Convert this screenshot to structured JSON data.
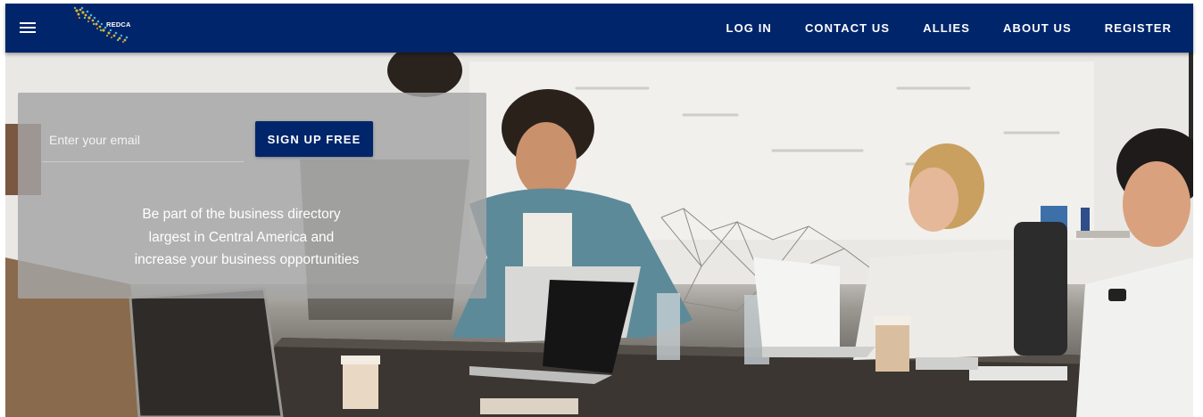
{
  "navbar": {
    "menu_icon": "hamburger-menu-icon",
    "logo_text": "REDCA",
    "links": [
      "LOG IN",
      "CONTACT US",
      "ALLIES",
      "ABOUT US",
      "REGISTER"
    ],
    "background_color": "#00256b"
  },
  "signup": {
    "email_placeholder": "Enter your email",
    "button_label": "SIGN UP FREE",
    "tagline": [
      "Be part of the business directory",
      "largest in Central America and",
      "increase your business opportunities"
    ]
  },
  "colors": {
    "brand_navy": "#00256b",
    "panel_overlay": "rgba(165,165,165,0.82)",
    "text_light": "#ffffff"
  }
}
